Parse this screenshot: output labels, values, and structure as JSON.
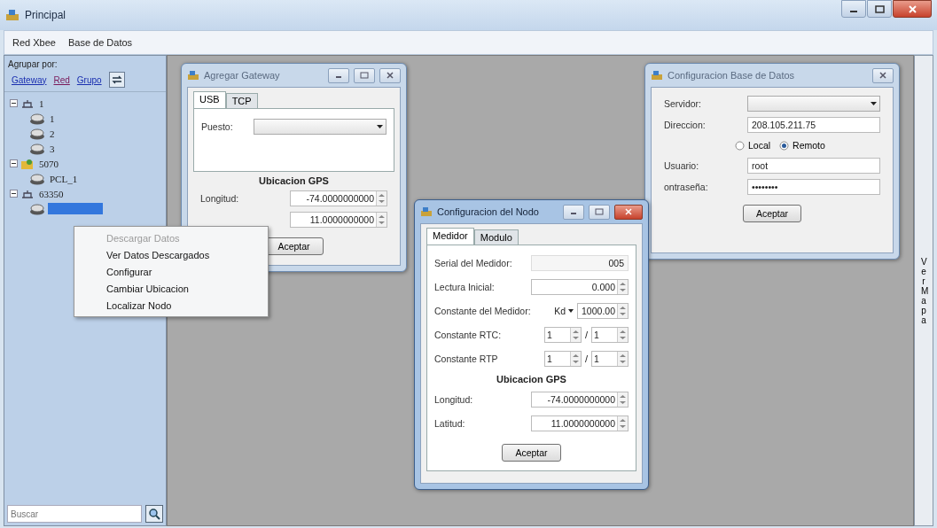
{
  "window": {
    "title": "Principal"
  },
  "menu": [
    "Red Xbee",
    "Base de Datos"
  ],
  "sidebar": {
    "group_label": "Agrupar por:",
    "group_links": [
      "Gateway",
      "Red",
      "Grupo"
    ],
    "tree": [
      {
        "label": "1",
        "kind": "network",
        "expanded": true,
        "selected": false,
        "children": [
          {
            "label": "1",
            "kind": "node",
            "selected": false
          },
          {
            "label": "2",
            "kind": "node",
            "selected": false
          },
          {
            "label": "3",
            "kind": "node",
            "selected": false
          }
        ]
      },
      {
        "label": "5070",
        "kind": "gateway",
        "expanded": true,
        "selected": false,
        "children": [
          {
            "label": "PCL_1",
            "kind": "node",
            "selected": false
          }
        ]
      },
      {
        "label": "63350",
        "kind": "network",
        "expanded": true,
        "selected": false,
        "children": [
          {
            "kind": "node",
            "selected": true
          }
        ]
      }
    ],
    "search": {
      "placeholder": "Buscar"
    }
  },
  "child_windows": [
    {
      "title": "Agregar Gateway",
      "active": false,
      "minimize_button": true,
      "maximize_button": true,
      "close_button": true,
      "tabs": [
        {
          "label": "USB",
          "selected": true
        },
        {
          "label": "TCP",
          "selected": false
        }
      ],
      "panel_rows": [
        {
          "kind": "dropdown",
          "label": "Puesto:"
        }
      ],
      "rows": [
        {
          "kind": "heading",
          "label": "Ubicacion GPS"
        },
        {
          "kind": "spin",
          "label": "Longitud:",
          "value": "-74.0000000000"
        },
        {
          "kind": "spin",
          "value": "11.0000000000"
        }
      ],
      "button": "Aceptar"
    },
    {
      "title": "Configuracion Base de Datos",
      "active": false,
      "minimize_button": false,
      "maximize_button": false,
      "close_button": true,
      "rows": [
        {
          "kind": "dropdown",
          "label": "Servidor:"
        },
        {
          "kind": "text",
          "label": "Direccion:",
          "value": "208.105.211.75"
        },
        {
          "kind": "radios",
          "options": [
            {
              "label": "Local",
              "selected": false
            },
            {
              "label": "Remoto",
              "selected": true
            }
          ]
        },
        {
          "kind": "text",
          "label": "Usuario:",
          "value": "root"
        },
        {
          "kind": "text",
          "label": "ontraseña:",
          "value": "••••••••"
        }
      ],
      "button": "Aceptar"
    },
    {
      "title": "Configuracion del Nodo",
      "active": true,
      "minimize_button": true,
      "maximize_button": true,
      "close_button": true,
      "tabs": [
        {
          "label": "Medidor",
          "selected": true
        },
        {
          "label": "Modulo",
          "selected": false
        }
      ],
      "panel_rows": [
        {
          "kind": "readonly",
          "label": "Serial del Medidor:",
          "value": "005"
        },
        {
          "kind": "spin",
          "label": "Lectura Inicial:",
          "value": "0.000"
        },
        {
          "kind": "combo-spin",
          "label": "Constante del Medidor:",
          "option": "Kd",
          "value": "1000.00"
        },
        {
          "kind": "spin-pair",
          "label": "Constante RTC:",
          "value": "1",
          "value_2": "1",
          "separator": "/"
        },
        {
          "kind": "spin-pair",
          "label": "Constante RTP",
          "value": "1",
          "value_2": "1",
          "separator": "/"
        },
        {
          "kind": "heading",
          "label": "Ubicacion GPS"
        },
        {
          "kind": "spin",
          "label": "Longitud:",
          "value": "-74.0000000000"
        },
        {
          "kind": "spin",
          "label": "Latitud:",
          "value": "11.0000000000"
        }
      ],
      "button": "Aceptar"
    }
  ],
  "context_menu": [
    {
      "label": "Descargar Datos",
      "disabled": true
    },
    {
      "label": "Ver Datos Descargados",
      "disabled": false
    },
    {
      "label": "Configurar",
      "disabled": false
    },
    {
      "label": "Cambiar Ubicacion",
      "disabled": false
    },
    {
      "label": "Localizar Nodo",
      "disabled": false
    }
  ],
  "side_button": "Ver Mapa"
}
